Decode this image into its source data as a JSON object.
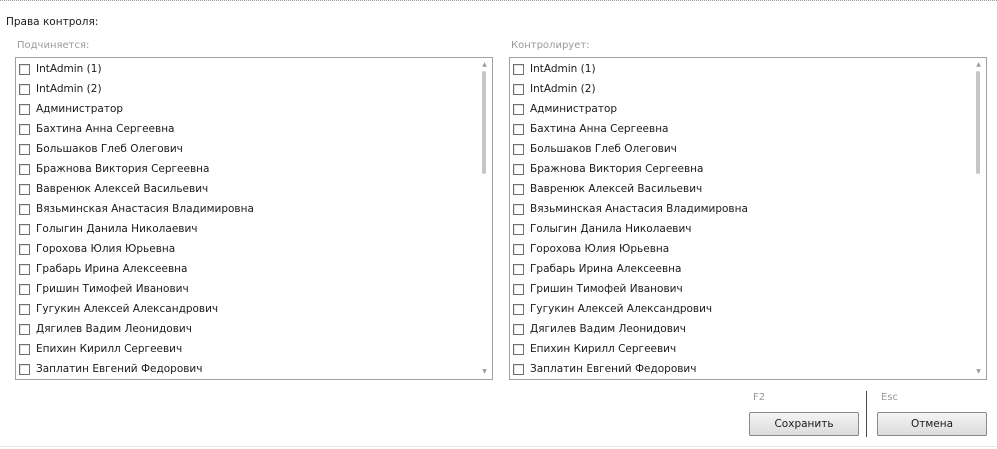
{
  "section_title": "Права контроля:",
  "left_panel": {
    "label": "Подчиняется:",
    "items": [
      "IntAdmin (1)",
      "IntAdmin (2)",
      "Администратор",
      "Бахтина Анна Сергеевна",
      "Большаков Глеб Олегович",
      "Бражнова Виктория Сергеевна",
      "Вавренюк Алексей Васильевич",
      "Вязьминская Анастасия Владимировна",
      "Голыгин Данила Николаевич",
      "Горохова Юлия Юрьевна",
      "Грабарь Ирина Алексеевна",
      "Гришин Тимофей Иванович",
      "Гугукин Алексей Александрович",
      "Дягилев Вадим Леонидович",
      "Епихин Кирилл Сергеевич",
      "Заплатин Евгений Федорович"
    ]
  },
  "right_panel": {
    "label": "Контролирует:",
    "items": [
      "IntAdmin (1)",
      "IntAdmin (2)",
      "Администратор",
      "Бахтина Анна Сергеевна",
      "Большаков Глеб Олегович",
      "Бражнова Виктория Сергеевна",
      "Вавренюк Алексей Васильевич",
      "Вязьминская Анастасия Владимировна",
      "Голыгин Данила Николаевич",
      "Горохова Юлия Юрьевна",
      "Грабарь Ирина Алексеевна",
      "Гришин Тимофей Иванович",
      "Гугукин Алексей Александрович",
      "Дягилев Вадим Леонидович",
      "Епихин Кирилл Сергеевич",
      "Заплатин Евгений Федорович"
    ]
  },
  "buttons": {
    "save": {
      "label": "Сохранить",
      "hotkey": "F2"
    },
    "cancel": {
      "label": "Отмена",
      "hotkey": "Esc"
    }
  },
  "icons": {
    "scroll_up": "chevron-up-icon",
    "scroll_down": "chevron-down-icon"
  }
}
